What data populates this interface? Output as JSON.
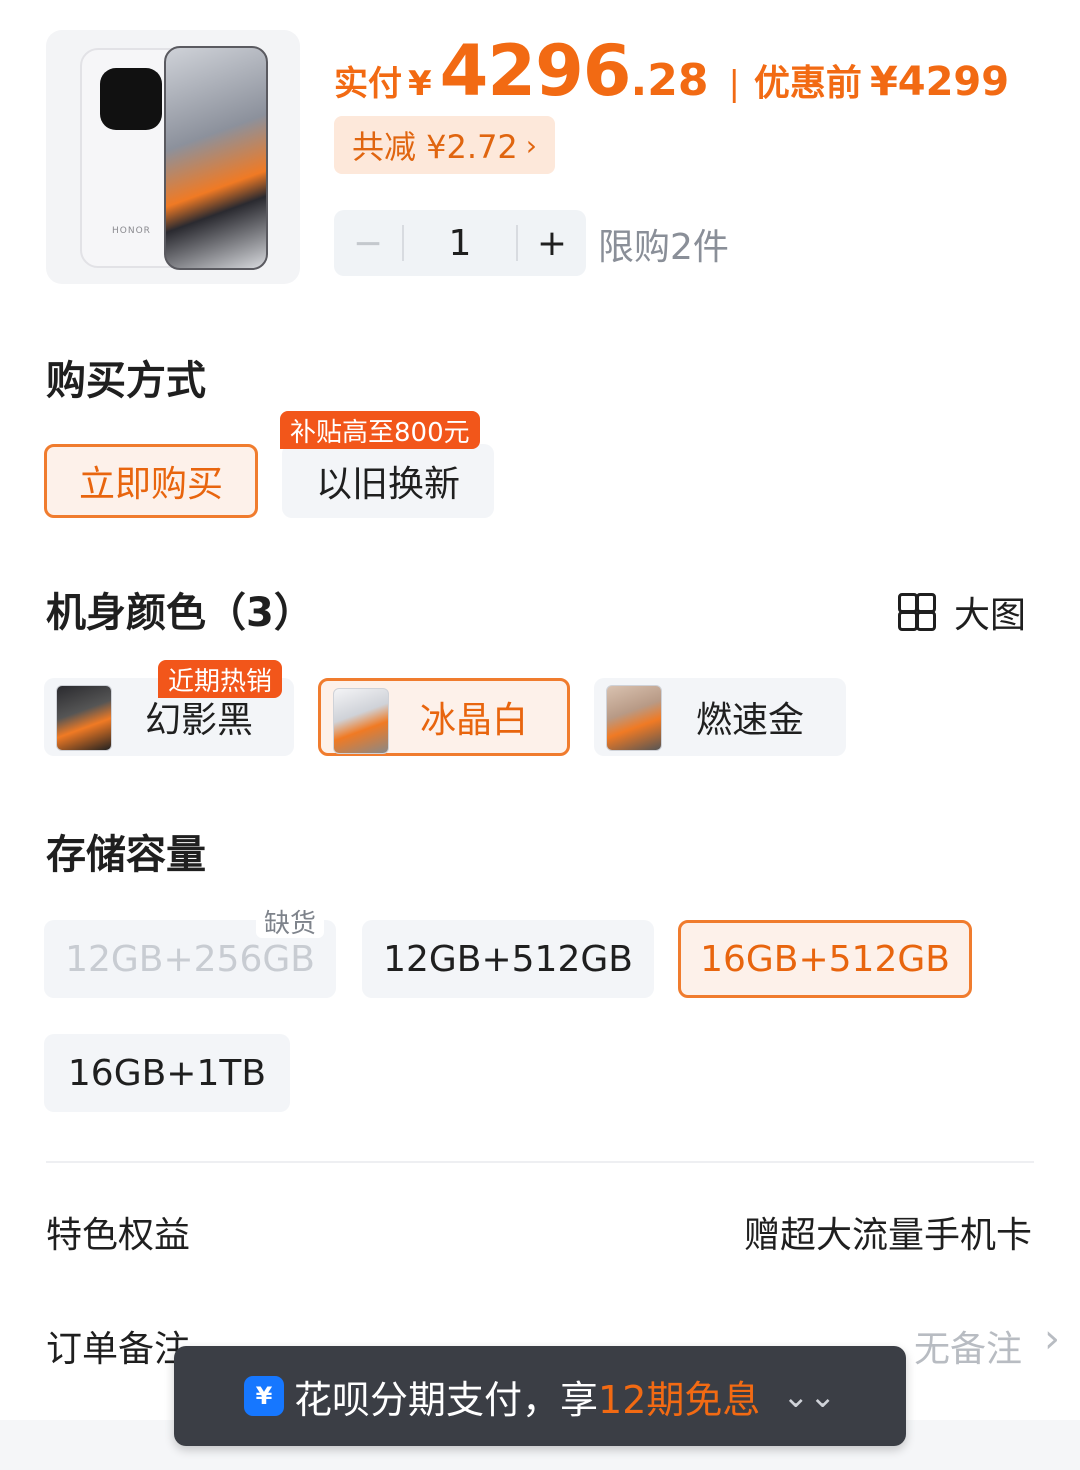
{
  "product": {
    "image_brand_text": "HONOR",
    "price_label": "实付",
    "currency": "¥",
    "price_int": "4296",
    "price_dec": ".28",
    "separator": "|",
    "orig_label": "优惠前",
    "orig_price": "¥4299",
    "discount_label": "共减 ¥2.72",
    "discount_chevron": "›",
    "qty_minus": "−",
    "qty_value": "1",
    "qty_plus": "+",
    "limit_text": "限购2件"
  },
  "purchase": {
    "title": "购买方式",
    "options": [
      {
        "label": "立即购买",
        "selected": true
      },
      {
        "label": "以旧换新",
        "selected": false,
        "tag": "补贴高至800元"
      }
    ]
  },
  "color": {
    "title": "机身颜色（3）",
    "big_view_label": "大图",
    "options": [
      {
        "label": "幻影黑",
        "selected": false,
        "tag": "近期热销"
      },
      {
        "label": "冰晶白",
        "selected": true
      },
      {
        "label": "燃速金",
        "selected": false
      }
    ]
  },
  "storage": {
    "title": "存储容量",
    "options": [
      {
        "label": "12GB+256GB",
        "disabled": true,
        "tag": "缺货"
      },
      {
        "label": "12GB+512GB",
        "selected": false
      },
      {
        "label": "16GB+512GB",
        "selected": true
      },
      {
        "label": "16GB+1TB",
        "selected": false
      }
    ]
  },
  "rows": {
    "benefit_label": "特色权益",
    "benefit_value": "赠超大流量手机卡",
    "note_label": "订单备注",
    "note_value": "无备注",
    "note_chevron": "›"
  },
  "banner": {
    "icon_char": "¥",
    "text_prefix": "花呗分期支付，享",
    "text_highlight": "12期免息",
    "expand_icon": "⌄⌄"
  },
  "colors": {
    "accent": "#f26a13",
    "selected_border": "#f07c2e",
    "tag_bg": "#f2561a",
    "option_bg": "#f3f5f8"
  }
}
